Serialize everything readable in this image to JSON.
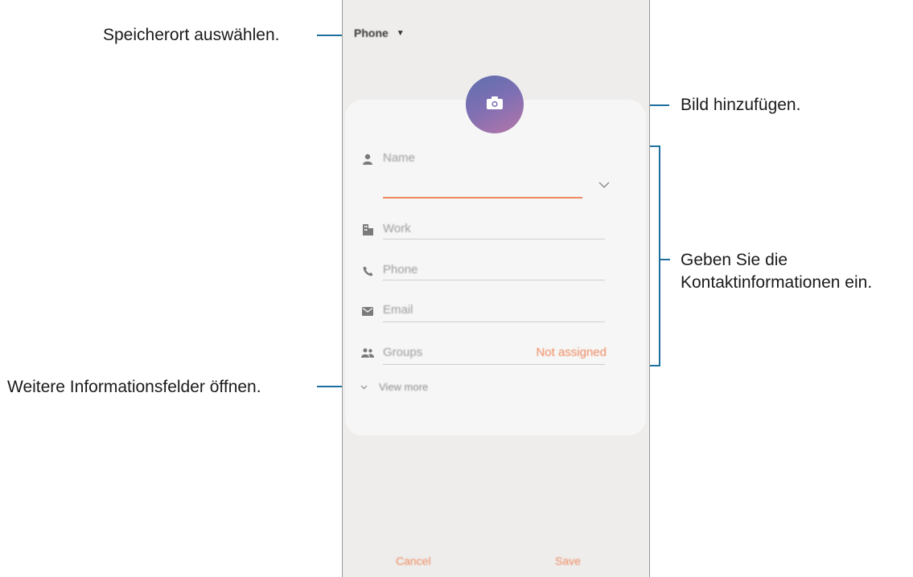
{
  "callouts": {
    "storage": "Speicherort auswählen.",
    "picture": "Bild hinzufügen.",
    "info_line1": "Geben Sie die",
    "info_line2": "Kontaktinformationen ein.",
    "more_fields": "Weitere Informationsfelder öffnen."
  },
  "phone": {
    "storage_selector": {
      "label": "Phone",
      "icon": "caret-down-icon"
    },
    "photo_button": {
      "icon": "camera-icon"
    },
    "fields": [
      {
        "icon": "person-icon",
        "label": "Name"
      },
      {
        "icon": "building-icon",
        "label": "Work"
      },
      {
        "icon": "phone-icon",
        "label": "Phone"
      },
      {
        "icon": "mail-icon",
        "label": "Email"
      },
      {
        "icon": "group-icon",
        "label": "Groups",
        "value": "Not assigned"
      }
    ],
    "view_more": "View more",
    "buttons": {
      "cancel": "Cancel",
      "save": "Save"
    }
  },
  "colors": {
    "accent": "#ef8a5f",
    "callout_line": "#1f6f9e",
    "screen_bg": "#eeedec",
    "card_bg": "#f6f6f6"
  }
}
